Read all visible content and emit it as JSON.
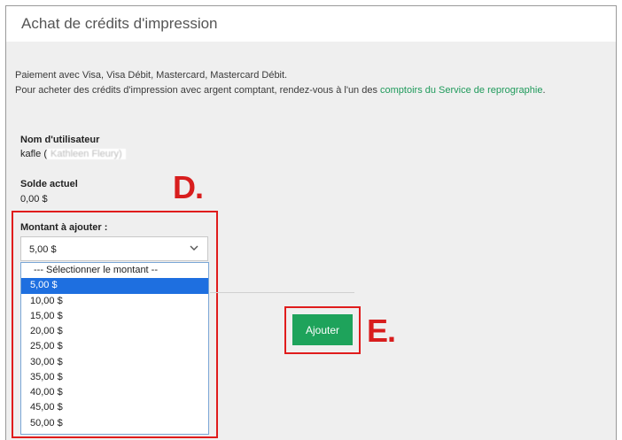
{
  "page": {
    "title": "Achat de crédits d'impression"
  },
  "info": {
    "payment_methods": "Paiement avec Visa, Visa Débit, Mastercard, Mastercard Débit.",
    "cash_prefix": "Pour acheter des crédits d'impression avec argent comptant, rendez-vous à l'un des ",
    "cash_link": "comptoirs du Service de reprographie",
    "cash_suffix": "."
  },
  "user": {
    "label": "Nom d'utilisateur",
    "username": "kafle",
    "paren_open": "(",
    "full_name": "Kathleen Fleury)"
  },
  "balance": {
    "label": "Solde actuel",
    "value": "0,00 $"
  },
  "amount": {
    "label": "Montant à ajouter :",
    "selected": "5,00 $",
    "options": [
      "--- Sélectionner le montant --",
      "5,00 $",
      "10,00 $",
      "15,00 $",
      "20,00 $",
      "25,00 $",
      "30,00 $",
      "35,00 $",
      "40,00 $",
      "45,00 $",
      "50,00 $"
    ],
    "highlighted_index": 1
  },
  "actions": {
    "add_label": "Ajouter"
  },
  "callouts": {
    "d": "D.",
    "e": "E."
  },
  "colors": {
    "link": "#1f9a5b",
    "button": "#1ea35b",
    "callout_red": "#e01c1c",
    "option_highlight": "#1e6fe0",
    "panel_bg": "#efefef"
  },
  "icons": {
    "select_arrow": "chevron-down-icon"
  }
}
